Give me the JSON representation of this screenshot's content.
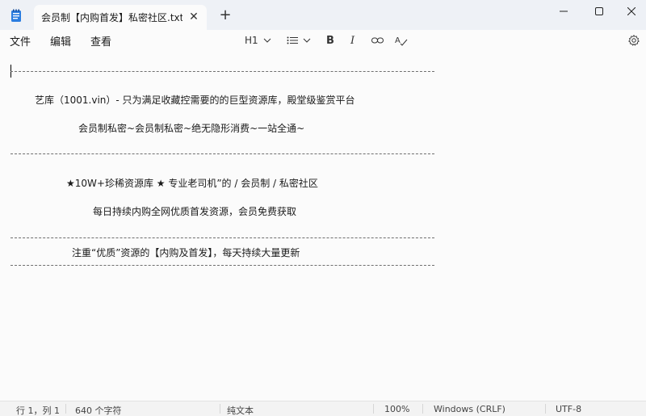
{
  "window": {
    "tab_title": "会员制【内购首发】私密社区.txt",
    "tab_close_glyph": "✕",
    "new_tab_glyph": "+",
    "minimize_glyph": "—",
    "maximize_glyph": "☐",
    "close_glyph": "✕"
  },
  "menu": {
    "file": "文件",
    "edit": "编辑",
    "view": "查看"
  },
  "format_toolbar": {
    "heading": "H1",
    "bold": "B",
    "italic": "I",
    "icons": [
      "list-icon",
      "link-icon",
      "spellcheck-icon",
      "gear-icon"
    ]
  },
  "document": {
    "lines": [
      "艺库（1001.vin）- 只为满足收藏控需要的的巨型资源库，殿堂级鉴赏平台",
      "会员制私密~会员制私密~绝无隐形消费~一站全通~",
      "★10W+珍稀资源库 ★ 专业老司机”的 / 会员制 / 私密社区",
      "每日持续内购全网优质首发资源，会员免费获取",
      "注重“优质”资源的【内购及首发】，每天持续大量更新"
    ]
  },
  "status": {
    "position": "行 1，列 1",
    "char_count": "640 个字符",
    "mode": "纯文本",
    "zoom": "100%",
    "line_ending": "Windows (CRLF)",
    "encoding": "UTF-8"
  },
  "colors": {
    "titlebar": "#eef1f6",
    "accent_icon": "#1e63c9"
  }
}
